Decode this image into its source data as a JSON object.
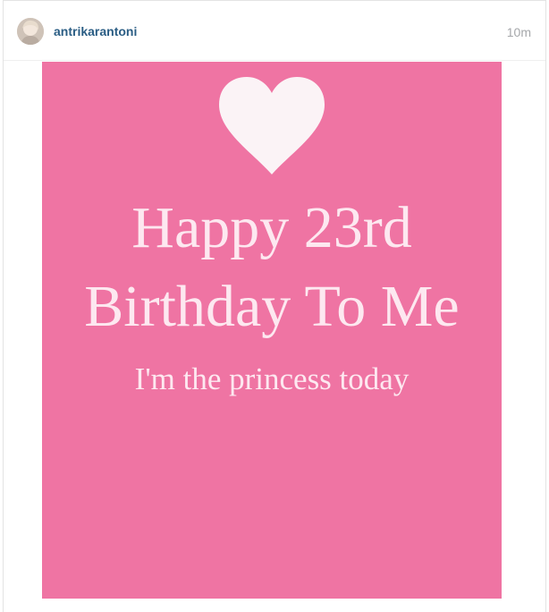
{
  "post": {
    "username": "antrikarantoni",
    "time_ago": "10m"
  },
  "image": {
    "background_color": "#ef74a3",
    "text_color": "#fde8f0",
    "icon": "heart-icon",
    "line1": "Happy 23rd",
    "line2": "Birthday To Me",
    "line3": "I'm the princess today"
  }
}
